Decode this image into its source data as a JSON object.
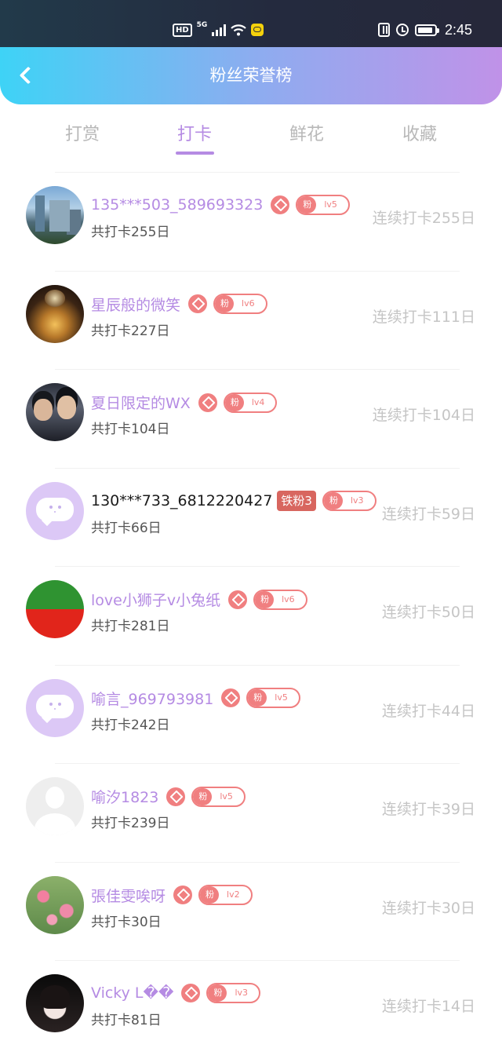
{
  "status_bar": {
    "hd": "HD",
    "network": "5G",
    "time": "2:45"
  },
  "header": {
    "title": "粉丝荣誉榜"
  },
  "tabs": [
    {
      "label": "打赏",
      "active": false
    },
    {
      "label": "打卡",
      "active": true
    },
    {
      "label": "鲜花",
      "active": false
    },
    {
      "label": "收藏",
      "active": false
    }
  ],
  "colors": {
    "accent": "#b58be3",
    "badge": "#f07f80",
    "iron_badge": "#d8665f",
    "header_gradient": [
      "#3ed3f6",
      "#c092e8"
    ]
  },
  "list": [
    {
      "name": "135***503_589693323",
      "fan_tag": "粉",
      "level": "lv5",
      "total": "共打卡255日",
      "streak": "连续打卡255日",
      "avatar": "city-photo"
    },
    {
      "name": "星辰般的微笑",
      "fan_tag": "粉",
      "level": "lv6",
      "total": "共打卡227日",
      "streak": "连续打卡111日",
      "avatar": "candle-photo"
    },
    {
      "name": "夏日限定的WX",
      "fan_tag": "粉",
      "level": "lv4",
      "total": "共打卡104日",
      "streak": "连续打卡104日",
      "avatar": "two-people-photo"
    },
    {
      "name": "130***733_6812220427",
      "iron": "铁粉3",
      "fan_tag": "粉",
      "level": "lv3",
      "total": "共打卡66日",
      "streak": "连续打卡59日",
      "avatar": "chat-bubble-default"
    },
    {
      "name": "love小狮子v小兔纸",
      "fan_tag": "粉",
      "level": "lv6",
      "total": "共打卡281日",
      "streak": "连续打卡50日",
      "avatar": "green-red-flag"
    },
    {
      "name": "喻言_969793981",
      "fan_tag": "粉",
      "level": "lv5",
      "total": "共打卡242日",
      "streak": "连续打卡44日",
      "avatar": "chat-bubble-default"
    },
    {
      "name": "喻汐1823",
      "fan_tag": "粉",
      "level": "lv5",
      "total": "共打卡239日",
      "streak": "连续打卡39日",
      "avatar": "default-person"
    },
    {
      "name": "張佳雯唉呀",
      "fan_tag": "粉",
      "level": "lv2",
      "total": "共打卡30日",
      "streak": "连续打卡30日",
      "avatar": "flowers-photo"
    },
    {
      "name": "Vicky L��",
      "fan_tag": "粉",
      "level": "lv3",
      "total": "共打卡81日",
      "streak": "连续打卡14日",
      "avatar": "girl-photo"
    }
  ]
}
